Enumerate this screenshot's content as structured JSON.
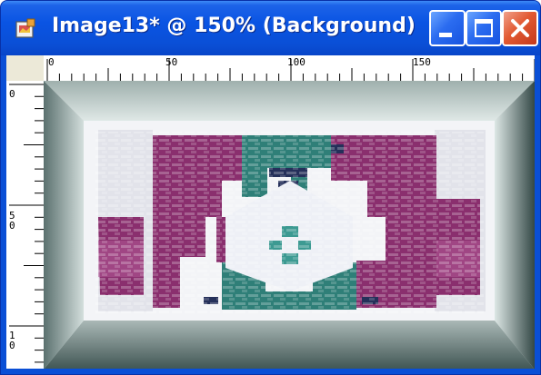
{
  "window": {
    "title": "Image13* @ 150% (Background)",
    "icon": "image-document-icon",
    "controls": {
      "minimize": "minimize-icon",
      "maximize": "maximize-icon",
      "close": "close-icon"
    }
  },
  "rulers": {
    "top_labels": [
      "0",
      "50",
      "100",
      "150"
    ],
    "left_labels": [
      "0",
      "5\n0",
      "1\n0"
    ]
  },
  "canvas": {
    "zoom": "150%",
    "layer": "Background",
    "image": "woven-pattern-button-image"
  },
  "colors": {
    "titlebar": "#0a4fd6",
    "close": "#e25a33",
    "pattern_purple": "#8a2f6e",
    "pattern_teal": "#2f7f78",
    "bevel_dark": "#3f5a58",
    "bevel_light": "#dce6e4"
  }
}
